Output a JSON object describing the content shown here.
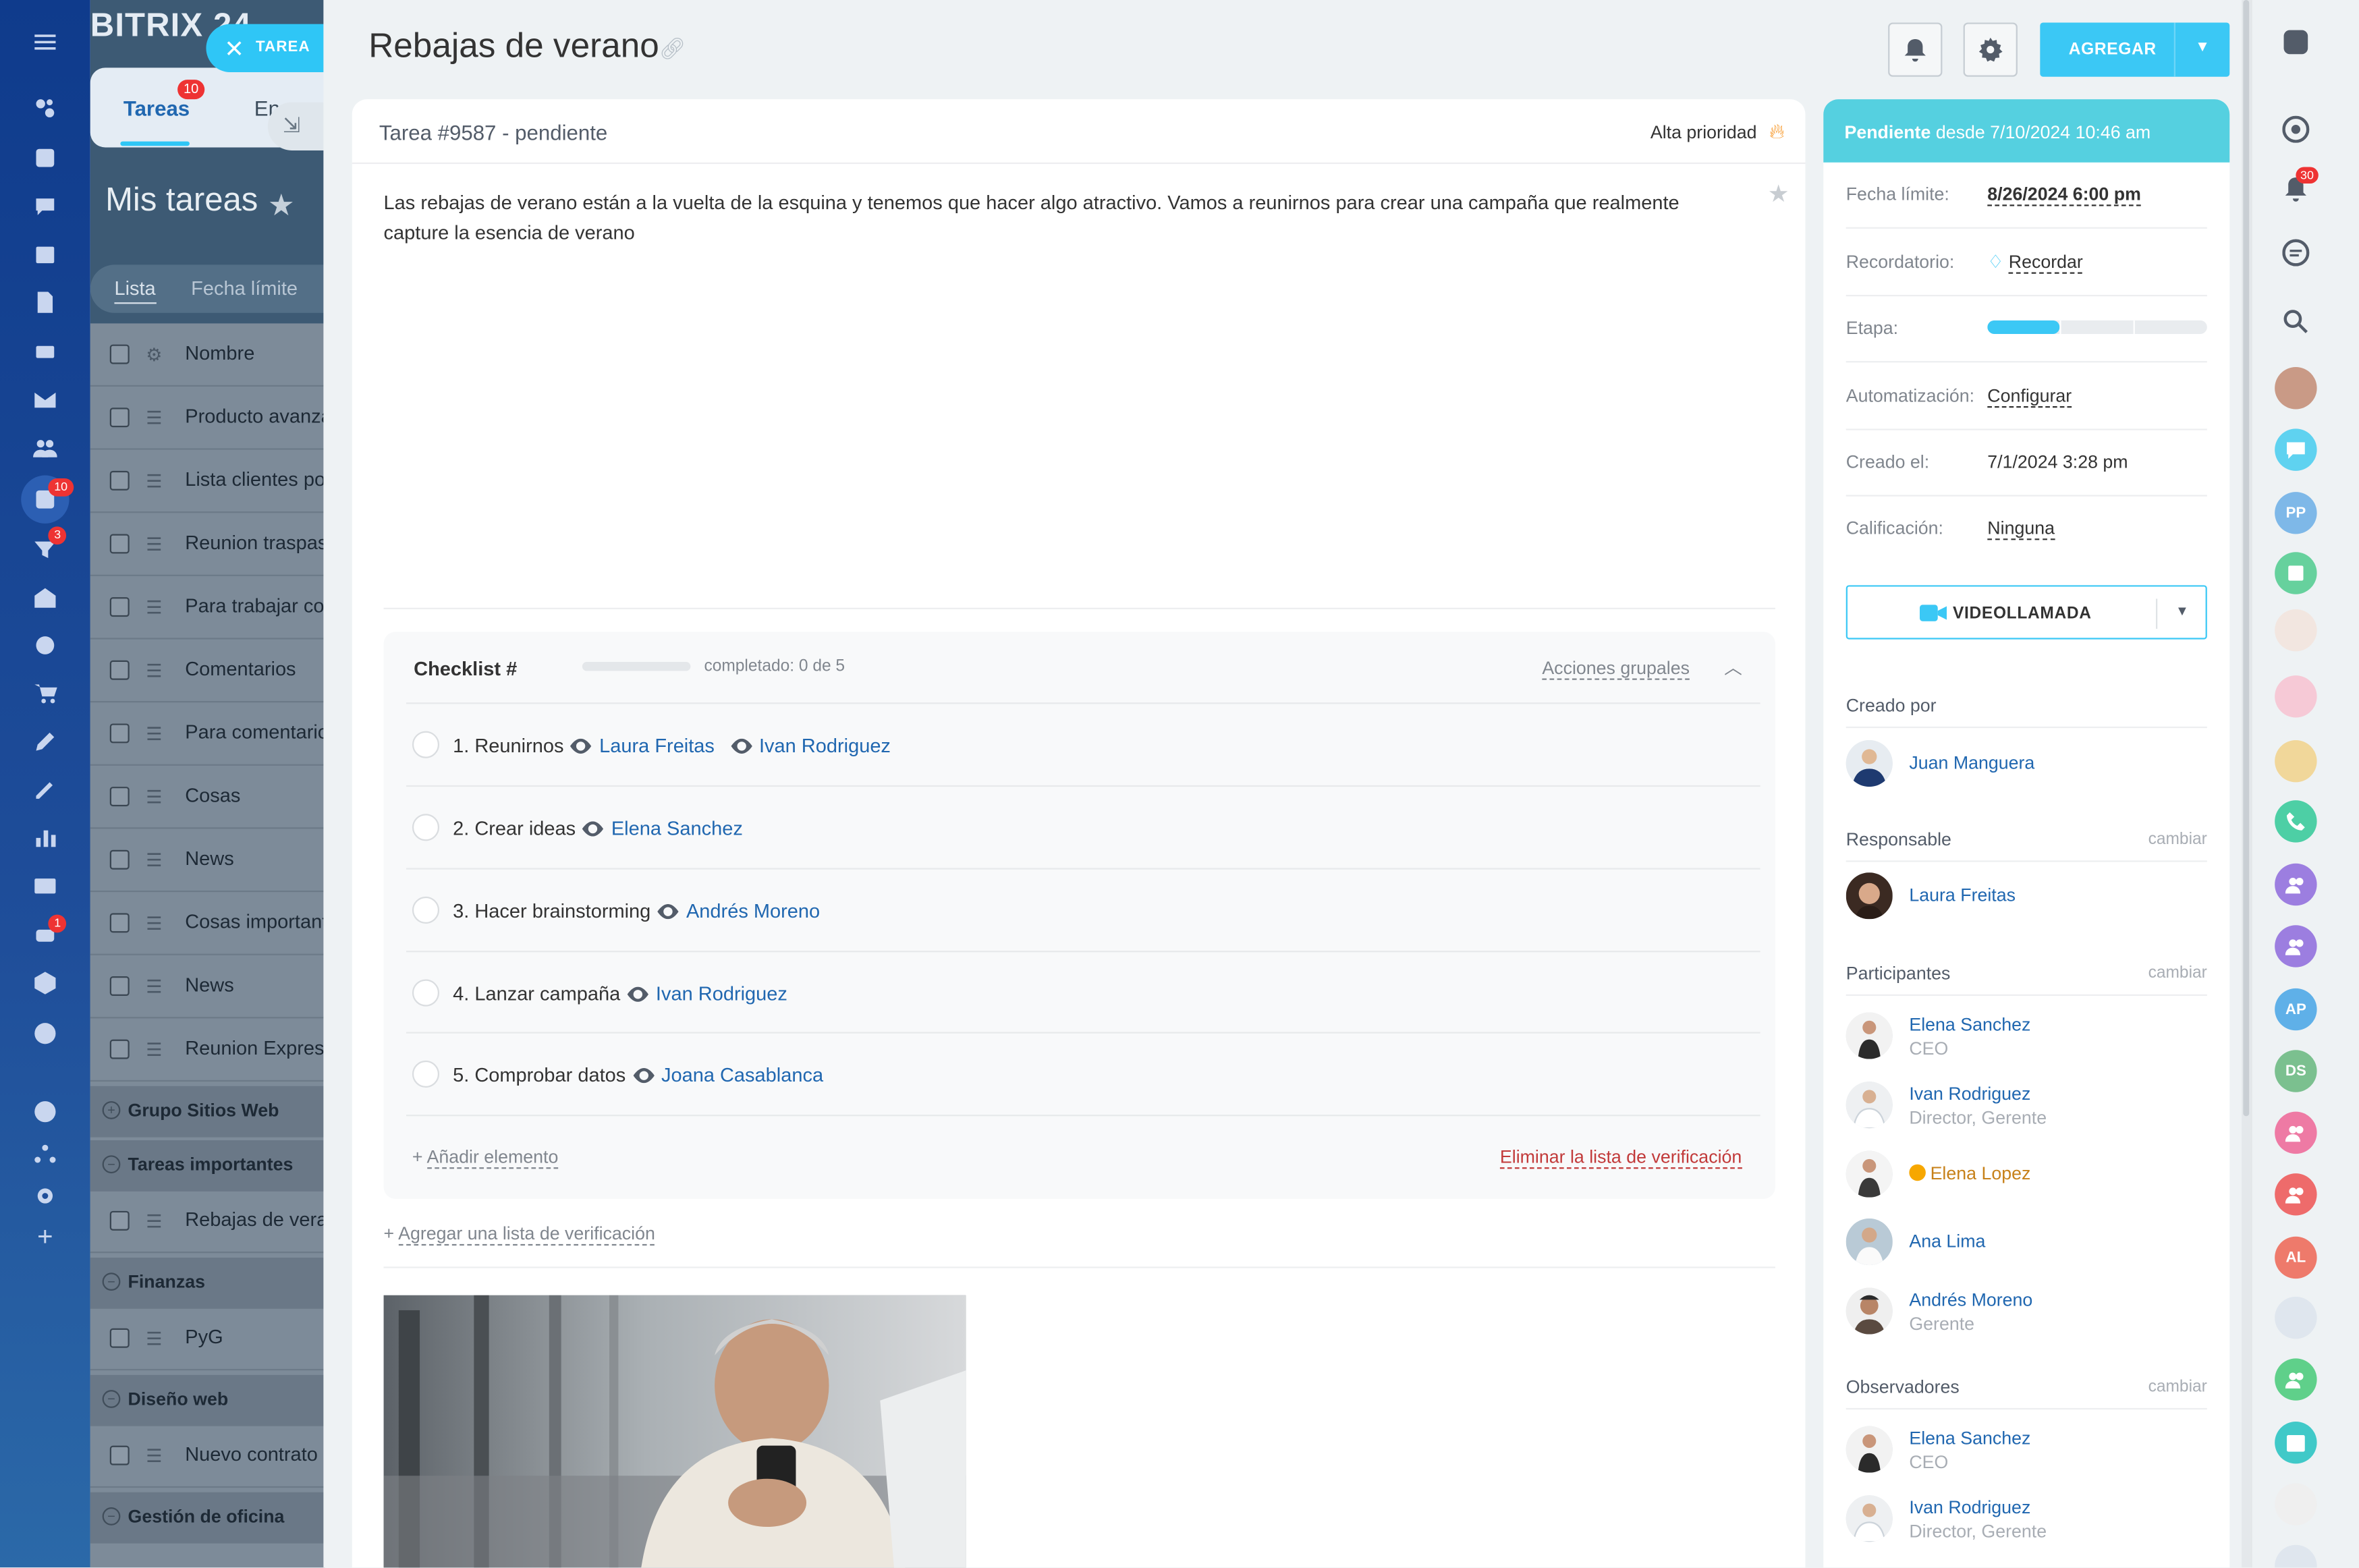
{
  "app": {
    "brand": "BITRIX 24",
    "nav_badges": {
      "tasks": "10",
      "filters": "3",
      "robots": "1"
    }
  },
  "background": {
    "tabs": {
      "tareas": "Tareas",
      "tareas_badge": "10",
      "other": "En"
    },
    "heading": "Mis tareas",
    "view_tabs": {
      "lista": "Lista",
      "fecha": "Fecha límite"
    },
    "column_header": "Nombre",
    "rows": [
      "Producto avanzado",
      "Lista clientes potenciales",
      "Reunion traspaso",
      "Para trabajar con",
      "Comentarios",
      "Para comentarios",
      "Cosas",
      "News",
      "Cosas importantes",
      "News",
      "Reunion Express"
    ],
    "groups": {
      "sitios": "Grupo Sitios Web",
      "importantes": "Tareas importantes",
      "importantes_row": "Rebajas de verano",
      "finanzas": "Finanzas",
      "finanzas_row": "PyG",
      "diseno": "Diseño web",
      "diseno_row": "Nuevo contrato",
      "oficina": "Gestión de oficina"
    }
  },
  "slider": {
    "close_label": "TAREA",
    "title": "Rebajas de verano",
    "add_button": "AGREGAR",
    "task_id": "Tarea #9587 - pendiente",
    "priority": "Alta prioridad",
    "description": "Las rebajas de verano están a la vuelta de la esquina y tenemos que hacer algo atractivo. Vamos a reunirnos para crear una campaña que realmente capture la esencia de verano",
    "checklist": {
      "title": "Checklist #",
      "completed": "completado: 0 de 5",
      "progress_fraction": 0,
      "group_actions": "Acciones grupales",
      "items": [
        {
          "title": "1. Reunirnos",
          "people": [
            "Laura Freitas",
            "Ivan Rodriguez"
          ]
        },
        {
          "title": "2. Crear ideas",
          "people": [
            "Elena Sanchez"
          ]
        },
        {
          "title": "3. Hacer brainstorming",
          "people": [
            "Andrés Moreno"
          ]
        },
        {
          "title": "4. Lanzar campaña",
          "people": [
            "Ivan Rodriguez"
          ]
        },
        {
          "title": "5. Comprobar datos",
          "people": [
            "Joana Casablanca"
          ]
        }
      ],
      "add_item": "Añadir elemento",
      "delete_list": "Eliminar la lista de verificación"
    },
    "add_checklist": "Agregar una lista de verificación"
  },
  "sidebar": {
    "status_label": "Pendiente",
    "status_since": "desde 7/10/2024 10:46 am",
    "fields": {
      "deadline": {
        "label": "Fecha límite:",
        "value": "8/26/2024 6:00 pm"
      },
      "reminder": {
        "label": "Recordatorio:",
        "value": "Recordar"
      },
      "stage": {
        "label": "Etapa:",
        "fraction": 0.33
      },
      "automation": {
        "label": "Automatización:",
        "value": "Configurar"
      },
      "created": {
        "label": "Creado el:",
        "value": "7/1/2024 3:28 pm"
      },
      "rating": {
        "label": "Calificación:",
        "value": "Ninguna"
      }
    },
    "videocall": "VIDEOLLAMADA",
    "change": "cambiar",
    "created_by": {
      "title": "Creado por",
      "name": "Juan Manguera"
    },
    "responsible": {
      "title": "Responsable",
      "name": "Laura Freitas"
    },
    "participants": {
      "title": "Participantes",
      "people": [
        {
          "name": "Elena Sanchez",
          "role": "CEO"
        },
        {
          "name": "Ivan Rodriguez",
          "role": "Director, Gerente"
        },
        {
          "name": "Elena Lopez",
          "role": ""
        },
        {
          "name": "Ana Lima",
          "role": ""
        },
        {
          "name": "Andrés Moreno",
          "role": "Gerente"
        }
      ]
    },
    "observers": {
      "title": "Observadores",
      "people": [
        {
          "name": "Elena Sanchez",
          "role": "CEO"
        },
        {
          "name": "Ivan Rodriguez",
          "role": "Director, Gerente"
        }
      ]
    }
  },
  "dock": {
    "notifications_badge": "30",
    "avatars": {
      "pp": "PP",
      "ap": "AP",
      "ds": "DS",
      "al": "AL"
    },
    "colors": {
      "accent": "#3bc8f5",
      "status": "#55d0e0",
      "purple": "#9c7ee0",
      "green": "#5fd08a",
      "red": "#ee6b6b"
    }
  }
}
